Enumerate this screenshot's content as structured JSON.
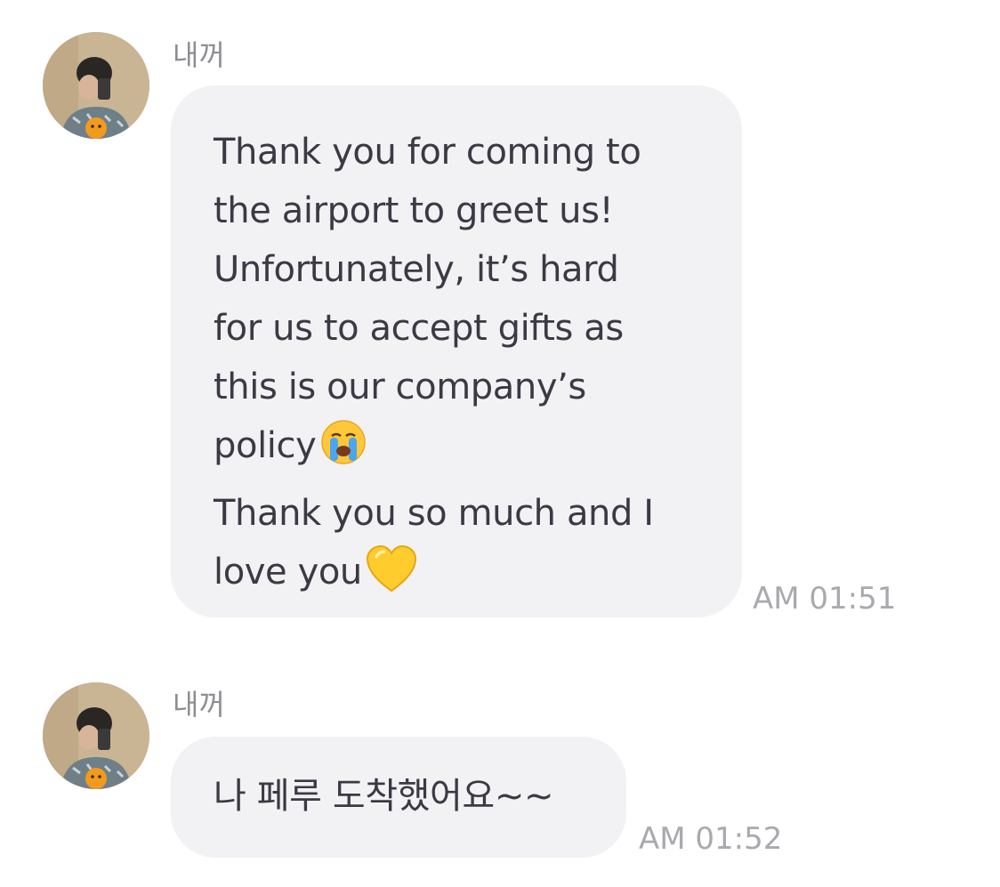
{
  "messages": [
    {
      "sender": "내꺼",
      "lines": [
        "Thank you for coming to",
        "the airport to greet us!",
        "Unfortunately, it’s hard",
        "for us to accept gifts as",
        "this is our company’s"
      ],
      "line_with_emoji": "policy",
      "emoji_1": "crying-face-emoji",
      "line_7": "Thank you so much and I",
      "line_8": "love you",
      "emoji_2": "yellow-heart-emoji",
      "time": "AM 01:51"
    },
    {
      "sender": "내꺼",
      "text": "나 페루 도착했어요~~",
      "time": "AM 01:52"
    }
  ],
  "colors": {
    "bubble": "#f2f2f4",
    "text": "#3b3a44",
    "sender": "#8e8e93",
    "time": "#a9a9ae"
  }
}
